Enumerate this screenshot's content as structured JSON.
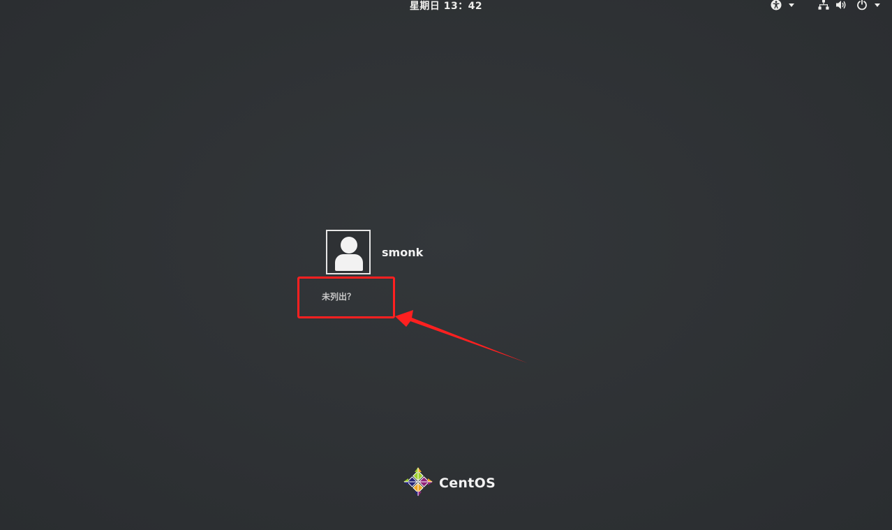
{
  "topbar": {
    "clock": "星期日 13：42",
    "icons": {
      "accessibility": "accessibility-icon",
      "network": "network-icon",
      "volume": "volume-icon",
      "power": "power-icon"
    }
  },
  "login": {
    "users": [
      {
        "name": "smonk",
        "avatar": "user-avatar-icon"
      }
    ],
    "not_listed_label": "未列出？"
  },
  "branding": {
    "logo_text": "CentOS"
  },
  "annotation": {
    "highlight_color": "#ff2020"
  },
  "colors": {
    "background": "#2e3134",
    "text": "#eeeeec"
  }
}
